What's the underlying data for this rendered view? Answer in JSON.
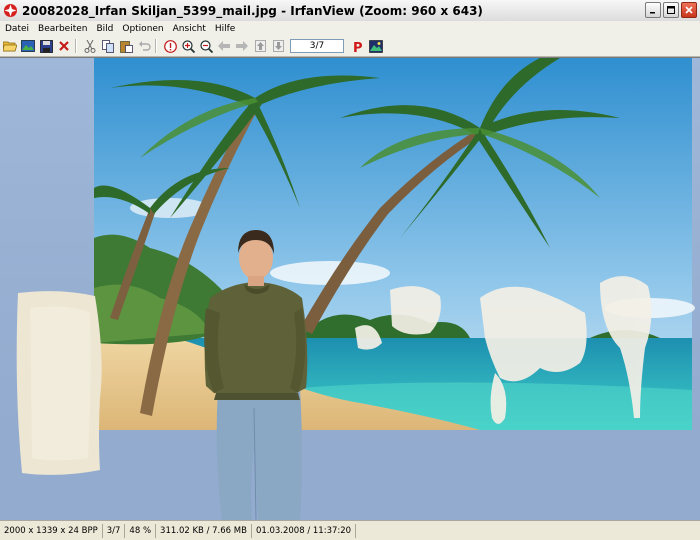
{
  "window": {
    "title": "20082028_Irfan Skiljan_5399_mail.jpg - IrfanView (Zoom: 960 x 643)"
  },
  "menu": {
    "items": [
      "Datei",
      "Bearbeiten",
      "Bild",
      "Optionen",
      "Ansicht",
      "Hilfe"
    ]
  },
  "toolbar": {
    "page_indicator": "3/7",
    "icons": [
      "open-folder-icon",
      "slideshow-icon",
      "save-icon",
      "delete-icon",
      "cut-icon",
      "copy-icon",
      "paste-icon",
      "undo-icon",
      "info-icon",
      "zoom-in-icon",
      "zoom-out-icon",
      "arrow-left-icon",
      "arrow-right-icon",
      "first-icon",
      "last-icon",
      "print-icon",
      "thumbnails-icon"
    ]
  },
  "status": {
    "dimensions": "2000 x 1339 x 24 BPP",
    "index": "3/7",
    "zoom": "48 %",
    "filesize": "311.02 KB / 7.66 MB",
    "datetime": "01.03.2008 / 11:37:20"
  },
  "colors": {
    "wall": "#95aed0",
    "sky": "#4a9fd8",
    "sea": "#1fb5b8",
    "sand": "#e8c88a",
    "sweater": "#5f6238",
    "jeans": "#8aa7c4"
  }
}
